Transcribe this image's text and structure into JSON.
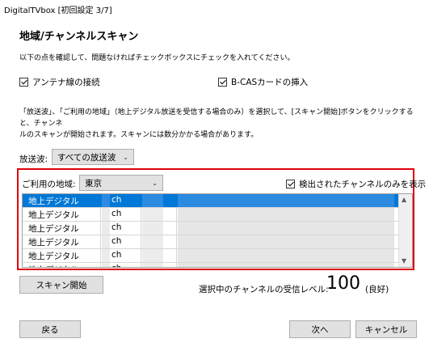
{
  "window": {
    "title": "DigitalTVbox [初回設定 3/7]"
  },
  "page": {
    "heading": "地域/チャンネルスキャン",
    "intro": "以下の点を確認して、問題なければチェックボックスにチェックを入れてください。",
    "checks": {
      "antenna": "アンテナ線の接続",
      "bcas": "B-CASカードの挿入"
    },
    "description_line1": "「放送波」、「ご利用の地域」（地上デジタル放送を受信する場合のみ）を選択して、[スキャン開始]ボタンをクリックすると、チャンネ",
    "description_line2": "ルのスキャンが開始されます。スキャンには数分かかる場合があります。"
  },
  "broadcast": {
    "label": "放送波:",
    "value": "すべての放送波"
  },
  "region": {
    "label": "ご利用の地域:",
    "value": "東京",
    "detected_only_label": "検出されたチャンネルのみを表示"
  },
  "channels": {
    "rows": [
      {
        "type": "地上デジタル",
        "ch": "ch"
      },
      {
        "type": "地上デジタル",
        "ch": "ch"
      },
      {
        "type": "地上デジタル",
        "ch": "ch"
      },
      {
        "type": "地上デジタル",
        "ch": "ch"
      },
      {
        "type": "地上デジタル",
        "ch": "ch"
      },
      {
        "type": "地上デジタル",
        "ch": "ch"
      }
    ]
  },
  "scan": {
    "start_label": "スキャン開始"
  },
  "signal": {
    "label": "選択中のチャンネルの受信レベル:",
    "value": "100",
    "quality": "(良好)"
  },
  "footer": {
    "back": "戻る",
    "next": "次へ",
    "cancel": "キャンセル"
  },
  "colors": {
    "highlight": "#e0000b",
    "selection": "#0078d7"
  }
}
